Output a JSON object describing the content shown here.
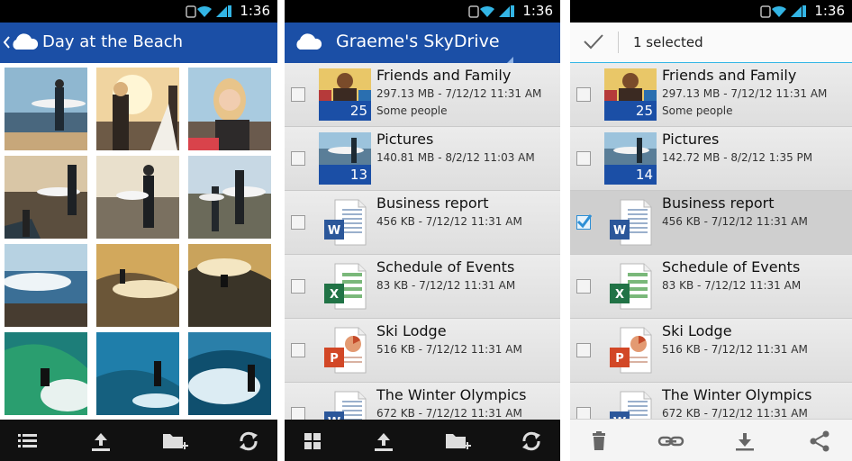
{
  "status": {
    "time": "1:36"
  },
  "photos_screen": {
    "title": "Day at the Beach",
    "thumbnails": [
      "surfer-on-rocks",
      "woman-at-sunset",
      "smiling-woman",
      "surfers-on-rocks",
      "surfer-walking-beach",
      "surfers-group",
      "wave-crash",
      "surfer-riding-wave",
      "golden-wave",
      "surfer-barrel",
      "surfer-paddling",
      "surfer-in-foam"
    ],
    "bottom_bar": [
      "list-view-icon",
      "upload-icon",
      "new-folder-icon",
      "refresh-icon"
    ]
  },
  "skydrive_screen": {
    "title": "Graeme's SkyDrive",
    "items": [
      {
        "name": "Friends and Family",
        "meta": "297.13 MB - 7/12/12 11:31 AM",
        "sub": "Some people",
        "type": "folder",
        "badge": "25"
      },
      {
        "name": "Pictures",
        "meta": "140.81 MB - 8/2/12 11:03 AM",
        "sub": "",
        "type": "folder",
        "badge": "13"
      },
      {
        "name": "Business report",
        "meta": "456 KB - 7/12/12 11:31 AM",
        "sub": "",
        "type": "word"
      },
      {
        "name": "Schedule of Events",
        "meta": "83 KB - 7/12/12 11:31 AM",
        "sub": "",
        "type": "excel"
      },
      {
        "name": "Ski Lodge",
        "meta": "516 KB - 7/12/12 11:31 AM",
        "sub": "",
        "type": "powerpoint"
      },
      {
        "name": "The Winter Olympics",
        "meta": "672 KB - 7/12/12 11:31 AM",
        "sub": "",
        "type": "word"
      }
    ],
    "bottom_bar": [
      "grid-view-icon",
      "upload-icon",
      "new-folder-icon",
      "refresh-icon"
    ]
  },
  "selection_screen": {
    "selected_label": "1 selected",
    "items": [
      {
        "name": "Friends and Family",
        "meta": "297.13 MB - 7/12/12 11:31 AM",
        "sub": "Some people",
        "type": "folder",
        "badge": "25",
        "checked": false
      },
      {
        "name": "Pictures",
        "meta": "142.72 MB - 8/2/12 1:35 PM",
        "sub": "",
        "type": "folder",
        "badge": "14",
        "checked": false
      },
      {
        "name": "Business report",
        "meta": "456 KB - 7/12/12 11:31 AM",
        "sub": "",
        "type": "word",
        "checked": true
      },
      {
        "name": "Schedule of Events",
        "meta": "83 KB - 7/12/12 11:31 AM",
        "sub": "",
        "type": "excel",
        "checked": false
      },
      {
        "name": "Ski Lodge",
        "meta": "516 KB - 7/12/12 11:31 AM",
        "sub": "",
        "type": "powerpoint",
        "checked": false
      },
      {
        "name": "The Winter Olympics",
        "meta": "672 KB - 7/12/12 11:31 AM",
        "sub": "",
        "type": "word",
        "checked": false
      }
    ],
    "bottom_bar": [
      "delete-icon",
      "share-link-icon",
      "download-icon",
      "share-icon"
    ]
  },
  "colors": {
    "accent": "#1b4fa6",
    "selection_underline": "#33b5e5",
    "word": "#2b579a",
    "excel": "#217346",
    "powerpoint": "#d24726"
  }
}
